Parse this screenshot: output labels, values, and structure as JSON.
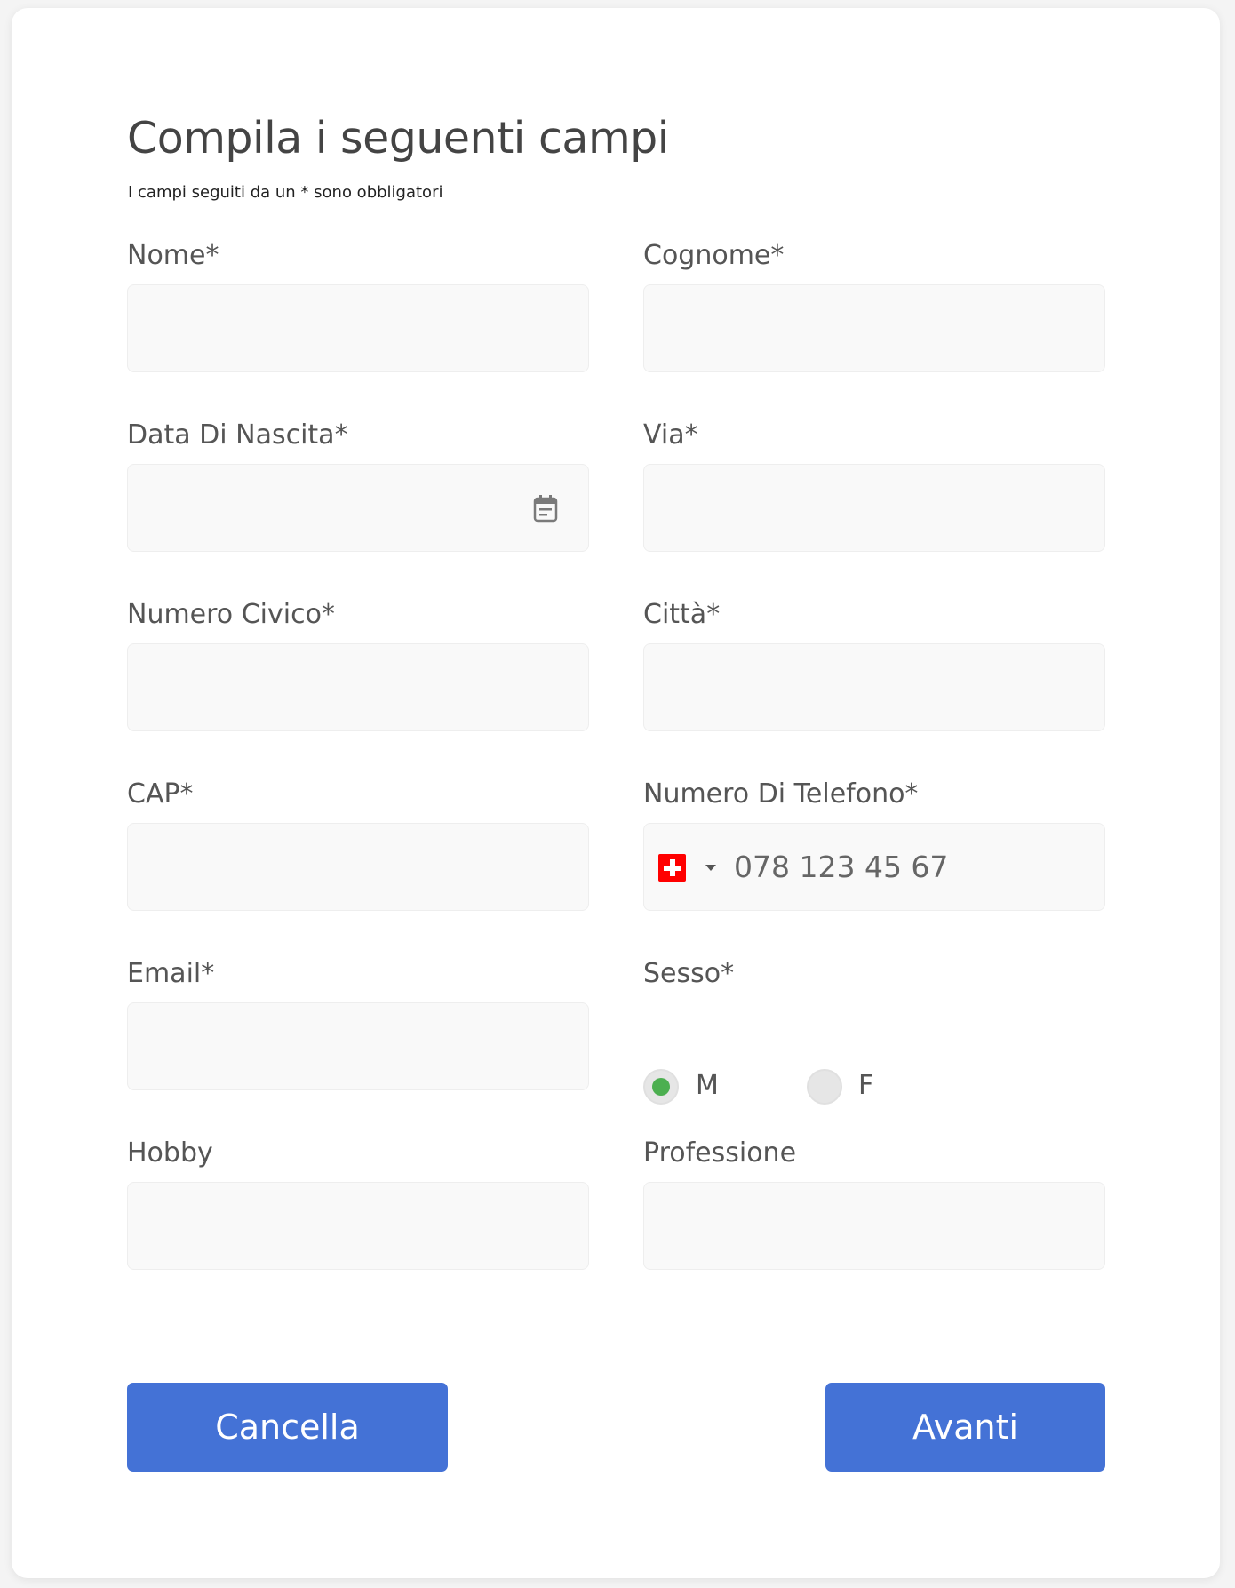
{
  "form": {
    "title": "Compila i seguenti campi",
    "subtitle": "I campi seguiti da un * sono obbligatori",
    "fields": {
      "nome": {
        "label": "Nome*",
        "value": ""
      },
      "cognome": {
        "label": "Cognome*",
        "value": ""
      },
      "data_nascita": {
        "label": "Data Di Nascita*",
        "value": ""
      },
      "via": {
        "label": "Via*",
        "value": ""
      },
      "numero_civico": {
        "label": "Numero Civico*",
        "value": ""
      },
      "citta": {
        "label": "Città*",
        "value": ""
      },
      "cap": {
        "label": "CAP*",
        "value": ""
      },
      "telefono": {
        "label": "Numero Di Telefono*",
        "placeholder": "078 123 45 67",
        "country_flag": "switzerland-flag-icon",
        "value": ""
      },
      "email": {
        "label": "Email*",
        "value": ""
      },
      "sesso": {
        "label": "Sesso*",
        "options": [
          "M",
          "F"
        ],
        "selected": "M"
      },
      "hobby": {
        "label": "Hobby",
        "value": ""
      },
      "professione": {
        "label": "Professione",
        "value": ""
      }
    },
    "buttons": {
      "cancel_label": "Cancella",
      "next_label": "Avanti"
    }
  },
  "colors": {
    "button_blue": "#4472d6",
    "radio_selected_green": "#4caf50",
    "input_background": "#f9f9f9",
    "flag_red": "#ff0000"
  }
}
